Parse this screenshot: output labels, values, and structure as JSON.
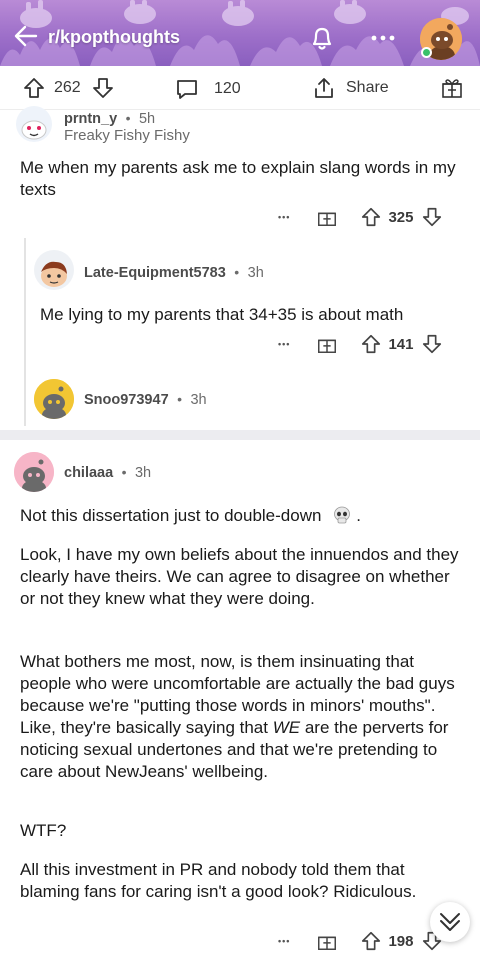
{
  "header": {
    "subreddit": "r/kpopthoughts",
    "colors": {
      "banner": "#9d6fc9",
      "accent": "#ffffff"
    },
    "icons": {
      "back": "back-arrow-icon",
      "bell": "bell-icon",
      "more": "more-horizontal-icon"
    }
  },
  "post_actions": {
    "upvotes": "262",
    "comments": "120",
    "share": "Share"
  },
  "comments": [
    {
      "author": "prntn_y",
      "time": "5h",
      "flair": "Freaky Fishy Fishy",
      "body": "Me when my parents ask me to explain slang words in my texts",
      "score": "325"
    },
    {
      "author": "Late-Equipment5783",
      "time": "3h",
      "body": "Me lying to my parents that 34+35 is about math",
      "score": "141"
    },
    {
      "author": "Snoo973947",
      "time": "3h"
    },
    {
      "author": "chilaaa",
      "time": "3h",
      "paragraphs": [
        "Not this dissertation just to double-down",
        "Look, I have my own beliefs about the innuendos and they clearly have theirs. We can agree to disagree on whether or not they knew what they were doing.",
        "What bothers me most, now, is them insinuating that people who were uncomfortable are actually the bad guys because we're \"putting those words in minors' mouths\". Like, they're basically saying that",
        "WE",
        " are the perverts for noticing sexual undertones and that we're pretending to care about NewJeans' wellbeing.",
        "WTF?",
        "All this investment in PR and nobody told them that blaming fans for caring isn't a good look? Ridiculous."
      ],
      "trailing_emoji": "skull-emoji",
      "trailing_period": ".",
      "score": "198"
    }
  ],
  "meta_separator": "•",
  "more_dots": "•••"
}
